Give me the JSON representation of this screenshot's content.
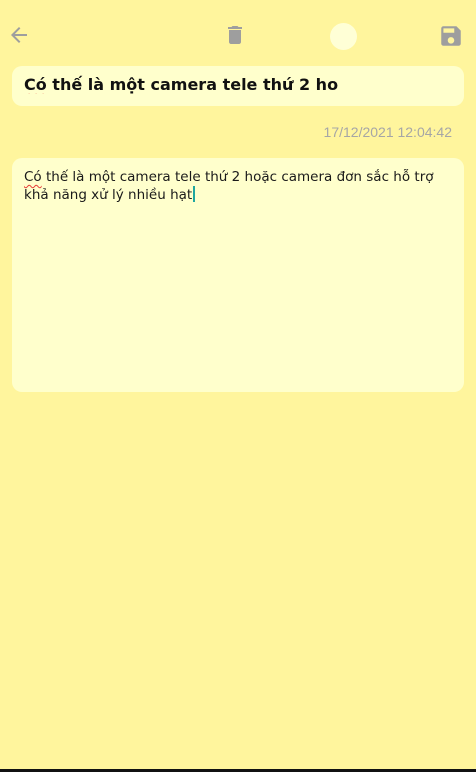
{
  "toolbar": {
    "back_icon": "arrow-back-icon",
    "delete_icon": "trash-icon",
    "color_icon": "color-dot-icon",
    "save_icon": "floppy-disk-icon",
    "icon_color": "#9e9e9e",
    "color_dot_color": "#ffffd6"
  },
  "note": {
    "title_first_word": "Có",
    "title_rest": " thế là một camera tele thứ 2 ho",
    "timestamp": "17/12/2021 12:04:42",
    "content_first_word": "Có",
    "content_rest": " thế là một camera tele thứ 2 hoặc camera đơn sắc hỗ trợ khả năng xử lý nhiều hạt"
  },
  "colors": {
    "background": "#fff59d",
    "card": "#ffffcc",
    "timestamp": "#a6a6a6",
    "caret": "#1fa7a0",
    "spellcheck": "#e53935"
  }
}
